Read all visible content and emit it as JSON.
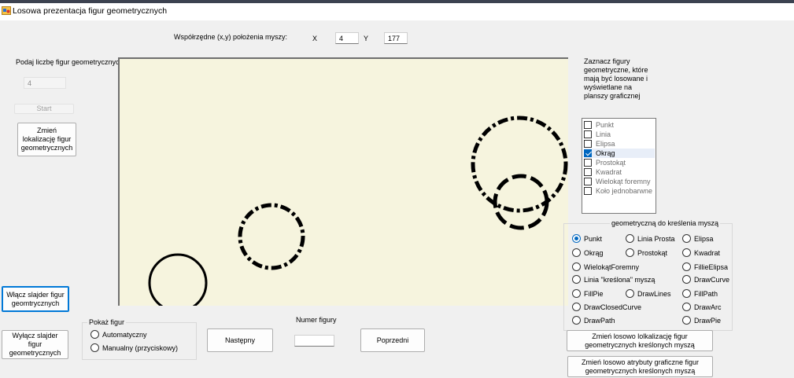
{
  "window": {
    "title": "Losowa prezentacja figur geometrycznych"
  },
  "mouse": {
    "label": "Współrzędne (x,y) położenia myszy:",
    "x_label": "X",
    "x_value": "4",
    "y_label": "Y",
    "y_value": "177"
  },
  "left_panel": {
    "count_label": "Podaj liczbę figur geometrycznych",
    "count_value": "4",
    "start_button": "Start",
    "change_location_button": "Zmień lokalizację figur geometrycznych",
    "slider_on_button": "Włącz slajder figur geomtrycznych",
    "slider_off_button": "Wyłącz slajder figur geometrycznych"
  },
  "show_group": {
    "title": "Pokaż figur",
    "options": [
      "Automatyczny",
      "Manualny (przyciskowy)"
    ]
  },
  "navigation": {
    "next_button": "Następny",
    "figure_number_label": "Numer figury",
    "figure_number_value": "",
    "prev_button": "Poprzedni"
  },
  "right_panel": {
    "instruction": "Zaznacz figury geometryczne, które mają być losowane i wyświetlane na planszy graficznej",
    "figures": [
      {
        "label": "Punkt",
        "checked": false
      },
      {
        "label": "Linia",
        "checked": false
      },
      {
        "label": "Elipsa",
        "checked": false
      },
      {
        "label": "Okrąg",
        "checked": true
      },
      {
        "label": "Prostokąt",
        "checked": false
      },
      {
        "label": "Kwadrat",
        "checked": false
      },
      {
        "label": "Wielokąt foremny",
        "checked": false
      },
      {
        "label": "Koło jednobarwne",
        "checked": false
      }
    ]
  },
  "draw_group": {
    "title": "geometryczną do kreślenia myszą",
    "options": [
      "Punkt",
      "Linia Prosta",
      "Elipsa",
      "Okrąg",
      "Prostokąt",
      "Kwadrat",
      "WielokątForemny",
      "FillieElipsa",
      "Linia \"kreślona\" myszą",
      "DrawCurve",
      "FillPie",
      "DrawLines",
      "FillPath",
      "DrawClosedCurve",
      "DrawArc",
      "DrawPath",
      "DrawPie"
    ],
    "selected": "Punkt"
  },
  "bottom_right": {
    "change_location_button": "Zmień losowo lolkalizację figur geometrycznych kreślonych myszą",
    "change_attributes_button": "Zmień losowo atrybuty graficzne figur geometrycznych kreślonych myszą"
  },
  "colors": {
    "canvas": "#f6f4de",
    "accent": "#0067c0",
    "window": "#f0f0f0"
  }
}
